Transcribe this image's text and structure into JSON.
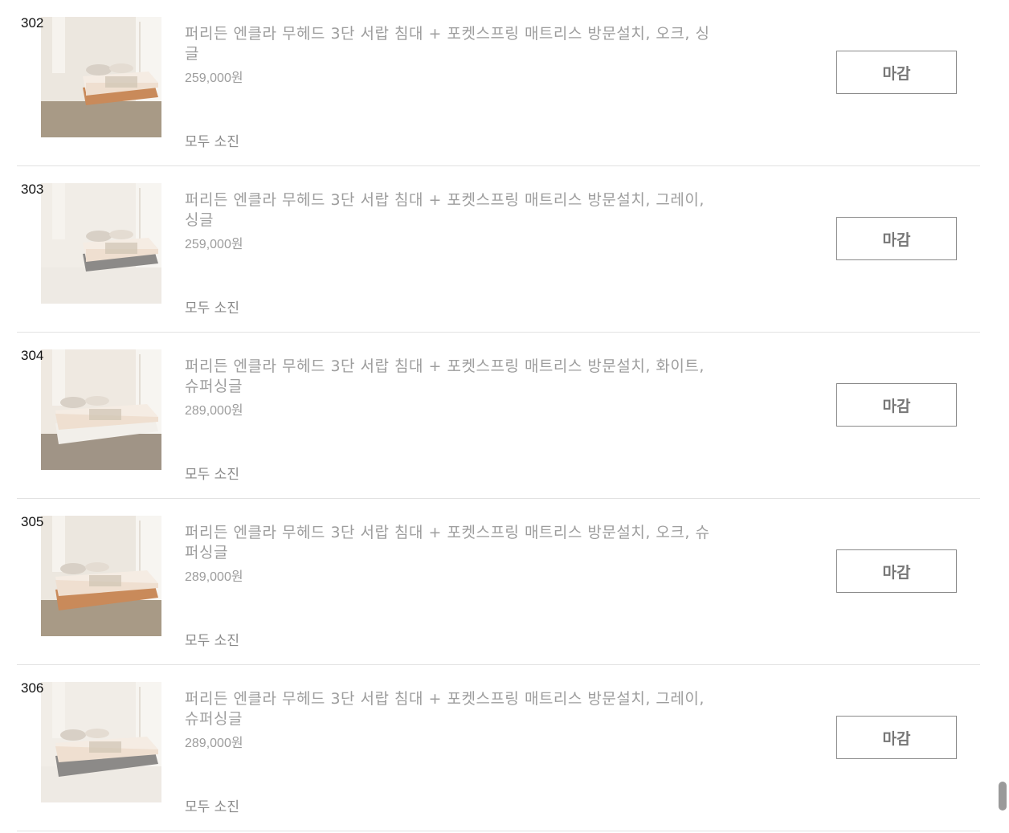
{
  "products": [
    {
      "number": "302",
      "title": "퍼리든 엔클라 무헤드 3단 서랍 침대 + 포켓스프링 매트리스 방문설치, 오크, 싱글",
      "price": "259,000원",
      "status": "모두 소진",
      "button_label": "마감",
      "image_alt": "oak drawer bed single",
      "frame_color": "#c98a5a",
      "floor_color": "#a89a86",
      "wall_color": "#ece7df"
    },
    {
      "number": "303",
      "title": "퍼리든 엔클라 무헤드 3단 서랍 침대 + 포켓스프링 매트리스 방문설치, 그레이, 싱글",
      "price": "259,000원",
      "status": "모두 소진",
      "button_label": "마감",
      "image_alt": "gray drawer bed single",
      "frame_color": "#8c8a88",
      "floor_color": "#eeeae4",
      "wall_color": "#f1ede7"
    },
    {
      "number": "304",
      "title": "퍼리든 엔클라 무헤드 3단 서랍 침대 + 포켓스프링 매트리스 방문설치, 화이트, 슈퍼싱글",
      "price": "289,000원",
      "status": "모두 소진",
      "button_label": "마감",
      "image_alt": "white drawer bed super single",
      "frame_color": "#f2efea",
      "floor_color": "#a09486",
      "wall_color": "#efe9e1"
    },
    {
      "number": "305",
      "title": "퍼리든 엔클라 무헤드 3단 서랍 침대 + 포켓스프링 매트리스 방문설치, 오크, 슈퍼싱글",
      "price": "289,000원",
      "status": "모두 소진",
      "button_label": "마감",
      "image_alt": "oak drawer bed super single",
      "frame_color": "#c98a5a",
      "floor_color": "#a89a86",
      "wall_color": "#ece7df"
    },
    {
      "number": "306",
      "title": "퍼리든 엔클라 무헤드 3단 서랍 침대 + 포켓스프링 매트리스 방문설치, 그레이, 슈퍼싱글",
      "price": "289,000원",
      "status": "모두 소진",
      "button_label": "마감",
      "image_alt": "gray drawer bed super single",
      "frame_color": "#8c8a88",
      "floor_color": "#eeeae4",
      "wall_color": "#f1ede7"
    }
  ],
  "colors": {
    "text_muted": "#9d9d9d",
    "button_border": "#8a8a8a",
    "divider": "#e2e2e2"
  }
}
